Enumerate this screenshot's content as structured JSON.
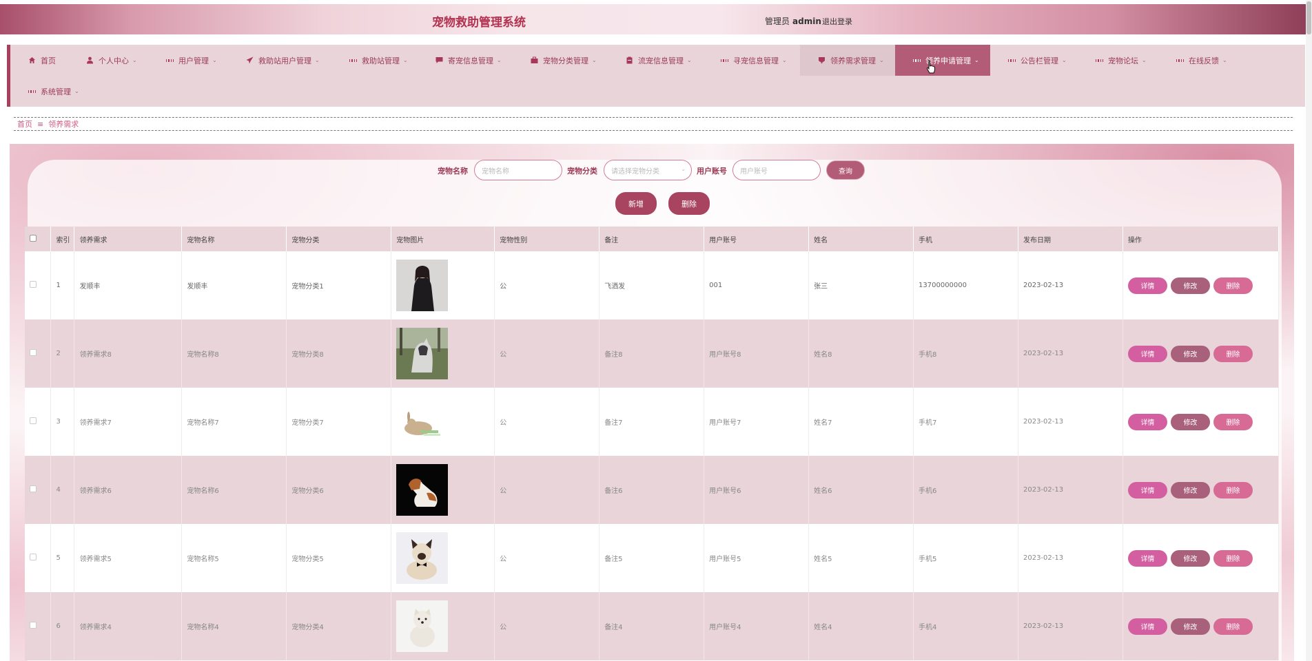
{
  "header": {
    "title": "宠物救助管理系统",
    "role": "管理员",
    "username": "admin",
    "logout": "退出登录"
  },
  "nav": {
    "items": [
      {
        "label": "首页",
        "icon": "home-icon"
      },
      {
        "label": "个人中心",
        "icon": "person-icon"
      },
      {
        "label": "用户管理",
        "icon": "grid-icon"
      },
      {
        "label": "救助站用户管理",
        "icon": "paper-plane-icon"
      },
      {
        "label": "救助站管理",
        "icon": "grid-icon"
      },
      {
        "label": "寄宠信息管理",
        "icon": "chat-icon"
      },
      {
        "label": "宠物分类管理",
        "icon": "briefcase-icon"
      },
      {
        "label": "流宠信息管理",
        "icon": "clipboard-icon"
      },
      {
        "label": "寻宠信息管理",
        "icon": "grid-icon"
      },
      {
        "label": "领养需求管理",
        "icon": "cup-icon"
      },
      {
        "label": "领养申请管理",
        "icon": "grid-icon"
      },
      {
        "label": "公告栏管理",
        "icon": "grid-icon"
      },
      {
        "label": "宠物论坛",
        "icon": "grid-icon"
      },
      {
        "label": "在线反馈",
        "icon": "grid-icon"
      },
      {
        "label": "系统管理",
        "icon": "grid-icon"
      }
    ]
  },
  "breadcrumb": {
    "home": "首页",
    "separator": "≡",
    "current": "领养需求"
  },
  "search": {
    "pet_name_label": "宠物名称",
    "pet_name_placeholder": "宠物名称",
    "category_label": "宠物分类",
    "category_placeholder": "请选择宠物分类",
    "account_label": "用户账号",
    "account_placeholder": "用户账号",
    "query_button": "查询"
  },
  "actions": {
    "add": "新增",
    "delete": "删除"
  },
  "table": {
    "headers": [
      "索引",
      "领养需求",
      "宠物名称",
      "宠物分类",
      "宠物图片",
      "宠物性别",
      "备注",
      "用户账号",
      "姓名",
      "手机",
      "发布日期",
      "操作"
    ],
    "row_actions": {
      "detail": "详情",
      "edit": "修改",
      "delete": "删除"
    },
    "rows": [
      {
        "index": "1",
        "need": "发顺丰",
        "name": "发顺丰",
        "category": "宠物分类1",
        "gender": "公",
        "note": "飞洒发",
        "account": "001",
        "person": "张三",
        "phone": "13700000000",
        "date": "2023-02-13",
        "image": "woman-photo"
      },
      {
        "index": "2",
        "need": "领养需求8",
        "name": "宠物名称8",
        "category": "宠物分类8",
        "gender": "公",
        "note": "备注8",
        "account": "用户账号8",
        "person": "姓名8",
        "phone": "手机8",
        "date": "2023-02-13",
        "image": "husky-photo"
      },
      {
        "index": "3",
        "need": "领养需求7",
        "name": "宠物名称7",
        "category": "宠物分类7",
        "gender": "公",
        "note": "备注7",
        "account": "用户账号7",
        "person": "姓名7",
        "phone": "手机7",
        "date": "2023-02-13",
        "image": "rabbit-photo"
      },
      {
        "index": "4",
        "need": "领养需求6",
        "name": "宠物名称6",
        "category": "宠物分类6",
        "gender": "公",
        "note": "备注6",
        "account": "用户账号6",
        "person": "姓名6",
        "phone": "手机6",
        "date": "2023-02-13",
        "image": "dog-black-bg-photo"
      },
      {
        "index": "5",
        "need": "领养需求5",
        "name": "宠物名称5",
        "category": "宠物分类5",
        "gender": "公",
        "note": "备注5",
        "account": "用户账号5",
        "person": "姓名5",
        "phone": "手机5",
        "date": "2023-02-13",
        "image": "siamese-cat-photo"
      },
      {
        "index": "6",
        "need": "领养需求4",
        "name": "宠物名称4",
        "category": "宠物分类4",
        "gender": "公",
        "note": "备注4",
        "account": "用户账号4",
        "person": "姓名4",
        "phone": "手机4",
        "date": "2023-02-13",
        "image": "white-dog-photo"
      }
    ]
  },
  "colors": {
    "brand": "#a83f5f",
    "nav_bg": "#e8d4d9",
    "active_nav": "#b35c78",
    "detail_btn": "#d35fa0",
    "edit_btn": "#a8607b",
    "delete_btn": "#d86a96"
  }
}
